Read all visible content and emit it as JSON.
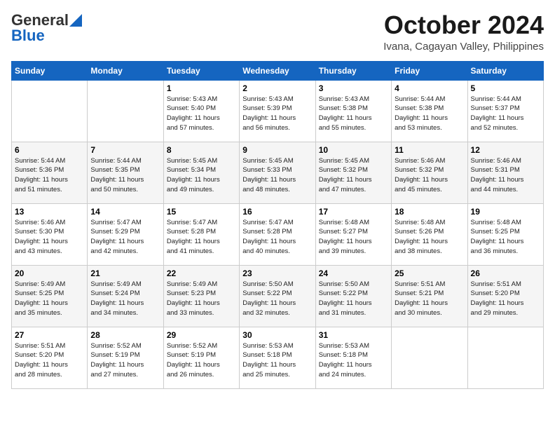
{
  "logo": {
    "general": "General",
    "blue": "Blue"
  },
  "header": {
    "month_title": "October 2024",
    "subtitle": "Ivana, Cagayan Valley, Philippines"
  },
  "days_of_week": [
    "Sunday",
    "Monday",
    "Tuesday",
    "Wednesday",
    "Thursday",
    "Friday",
    "Saturday"
  ],
  "weeks": [
    [
      {
        "day": "",
        "info": ""
      },
      {
        "day": "",
        "info": ""
      },
      {
        "day": "1",
        "info": "Sunrise: 5:43 AM\nSunset: 5:40 PM\nDaylight: 11 hours\nand 57 minutes."
      },
      {
        "day": "2",
        "info": "Sunrise: 5:43 AM\nSunset: 5:39 PM\nDaylight: 11 hours\nand 56 minutes."
      },
      {
        "day": "3",
        "info": "Sunrise: 5:43 AM\nSunset: 5:38 PM\nDaylight: 11 hours\nand 55 minutes."
      },
      {
        "day": "4",
        "info": "Sunrise: 5:44 AM\nSunset: 5:38 PM\nDaylight: 11 hours\nand 53 minutes."
      },
      {
        "day": "5",
        "info": "Sunrise: 5:44 AM\nSunset: 5:37 PM\nDaylight: 11 hours\nand 52 minutes."
      }
    ],
    [
      {
        "day": "6",
        "info": "Sunrise: 5:44 AM\nSunset: 5:36 PM\nDaylight: 11 hours\nand 51 minutes."
      },
      {
        "day": "7",
        "info": "Sunrise: 5:44 AM\nSunset: 5:35 PM\nDaylight: 11 hours\nand 50 minutes."
      },
      {
        "day": "8",
        "info": "Sunrise: 5:45 AM\nSunset: 5:34 PM\nDaylight: 11 hours\nand 49 minutes."
      },
      {
        "day": "9",
        "info": "Sunrise: 5:45 AM\nSunset: 5:33 PM\nDaylight: 11 hours\nand 48 minutes."
      },
      {
        "day": "10",
        "info": "Sunrise: 5:45 AM\nSunset: 5:32 PM\nDaylight: 11 hours\nand 47 minutes."
      },
      {
        "day": "11",
        "info": "Sunrise: 5:46 AM\nSunset: 5:32 PM\nDaylight: 11 hours\nand 45 minutes."
      },
      {
        "day": "12",
        "info": "Sunrise: 5:46 AM\nSunset: 5:31 PM\nDaylight: 11 hours\nand 44 minutes."
      }
    ],
    [
      {
        "day": "13",
        "info": "Sunrise: 5:46 AM\nSunset: 5:30 PM\nDaylight: 11 hours\nand 43 minutes."
      },
      {
        "day": "14",
        "info": "Sunrise: 5:47 AM\nSunset: 5:29 PM\nDaylight: 11 hours\nand 42 minutes."
      },
      {
        "day": "15",
        "info": "Sunrise: 5:47 AM\nSunset: 5:28 PM\nDaylight: 11 hours\nand 41 minutes."
      },
      {
        "day": "16",
        "info": "Sunrise: 5:47 AM\nSunset: 5:28 PM\nDaylight: 11 hours\nand 40 minutes."
      },
      {
        "day": "17",
        "info": "Sunrise: 5:48 AM\nSunset: 5:27 PM\nDaylight: 11 hours\nand 39 minutes."
      },
      {
        "day": "18",
        "info": "Sunrise: 5:48 AM\nSunset: 5:26 PM\nDaylight: 11 hours\nand 38 minutes."
      },
      {
        "day": "19",
        "info": "Sunrise: 5:48 AM\nSunset: 5:25 PM\nDaylight: 11 hours\nand 36 minutes."
      }
    ],
    [
      {
        "day": "20",
        "info": "Sunrise: 5:49 AM\nSunset: 5:25 PM\nDaylight: 11 hours\nand 35 minutes."
      },
      {
        "day": "21",
        "info": "Sunrise: 5:49 AM\nSunset: 5:24 PM\nDaylight: 11 hours\nand 34 minutes."
      },
      {
        "day": "22",
        "info": "Sunrise: 5:49 AM\nSunset: 5:23 PM\nDaylight: 11 hours\nand 33 minutes."
      },
      {
        "day": "23",
        "info": "Sunrise: 5:50 AM\nSunset: 5:22 PM\nDaylight: 11 hours\nand 32 minutes."
      },
      {
        "day": "24",
        "info": "Sunrise: 5:50 AM\nSunset: 5:22 PM\nDaylight: 11 hours\nand 31 minutes."
      },
      {
        "day": "25",
        "info": "Sunrise: 5:51 AM\nSunset: 5:21 PM\nDaylight: 11 hours\nand 30 minutes."
      },
      {
        "day": "26",
        "info": "Sunrise: 5:51 AM\nSunset: 5:20 PM\nDaylight: 11 hours\nand 29 minutes."
      }
    ],
    [
      {
        "day": "27",
        "info": "Sunrise: 5:51 AM\nSunset: 5:20 PM\nDaylight: 11 hours\nand 28 minutes."
      },
      {
        "day": "28",
        "info": "Sunrise: 5:52 AM\nSunset: 5:19 PM\nDaylight: 11 hours\nand 27 minutes."
      },
      {
        "day": "29",
        "info": "Sunrise: 5:52 AM\nSunset: 5:19 PM\nDaylight: 11 hours\nand 26 minutes."
      },
      {
        "day": "30",
        "info": "Sunrise: 5:53 AM\nSunset: 5:18 PM\nDaylight: 11 hours\nand 25 minutes."
      },
      {
        "day": "31",
        "info": "Sunrise: 5:53 AM\nSunset: 5:18 PM\nDaylight: 11 hours\nand 24 minutes."
      },
      {
        "day": "",
        "info": ""
      },
      {
        "day": "",
        "info": ""
      }
    ]
  ]
}
